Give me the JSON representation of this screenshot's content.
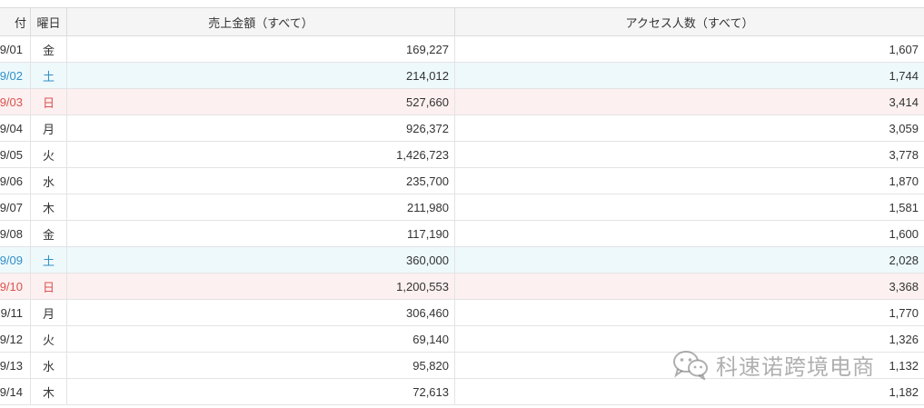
{
  "table": {
    "headers": {
      "date": "付",
      "day": "曜日",
      "sales": "売上金額（すべて）",
      "access": "アクセス人数（すべて）"
    },
    "rows": [
      {
        "date": "9/01",
        "day": "金",
        "sales": "169,227",
        "access": "1,607",
        "type": "weekday"
      },
      {
        "date": "9/02",
        "day": "土",
        "sales": "214,012",
        "access": "1,744",
        "type": "sat"
      },
      {
        "date": "9/03",
        "day": "日",
        "sales": "527,660",
        "access": "3,414",
        "type": "sun"
      },
      {
        "date": "9/04",
        "day": "月",
        "sales": "926,372",
        "access": "3,059",
        "type": "weekday"
      },
      {
        "date": "9/05",
        "day": "火",
        "sales": "1,426,723",
        "access": "3,778",
        "type": "weekday"
      },
      {
        "date": "9/06",
        "day": "水",
        "sales": "235,700",
        "access": "1,870",
        "type": "weekday"
      },
      {
        "date": "9/07",
        "day": "木",
        "sales": "211,980",
        "access": "1,581",
        "type": "weekday"
      },
      {
        "date": "9/08",
        "day": "金",
        "sales": "117,190",
        "access": "1,600",
        "type": "weekday"
      },
      {
        "date": "9/09",
        "day": "土",
        "sales": "360,000",
        "access": "2,028",
        "type": "sat"
      },
      {
        "date": "9/10",
        "day": "日",
        "sales": "1,200,553",
        "access": "3,368",
        "type": "sun"
      },
      {
        "date": "9/11",
        "day": "月",
        "sales": "306,460",
        "access": "1,770",
        "type": "weekday"
      },
      {
        "date": "9/12",
        "day": "火",
        "sales": "69,140",
        "access": "1,326",
        "type": "weekday"
      },
      {
        "date": "9/13",
        "day": "水",
        "sales": "95,820",
        "access": "1,132",
        "type": "weekday"
      },
      {
        "date": "9/14",
        "day": "木",
        "sales": "72,613",
        "access": "1,182",
        "type": "weekday"
      }
    ]
  },
  "colors": {
    "saturday_text": "#2f8fc8",
    "saturday_bg": "#eef9fc",
    "sunday_text": "#d9534f",
    "sunday_bg": "#fdf0f0"
  },
  "watermark": {
    "icon": "wechat-icon",
    "text": "科速诺跨境电商"
  }
}
